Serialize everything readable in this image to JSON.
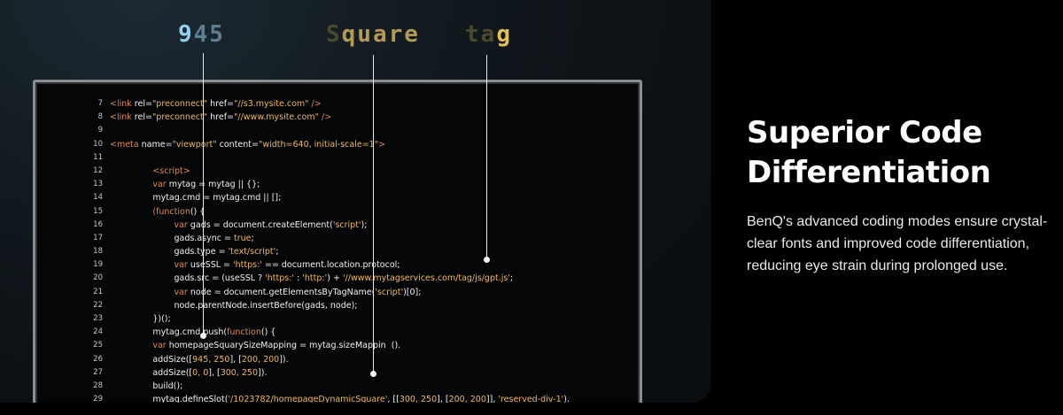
{
  "callouts": {
    "word1": {
      "parts": [
        "9",
        "45"
      ]
    },
    "word2": {
      "parts": [
        "S",
        "quare"
      ]
    },
    "word3": {
      "parts": [
        "ta",
        "g"
      ]
    }
  },
  "code_lines": [
    {
      "n": "7",
      "segs": [
        [
          "t",
          "<link "
        ],
        [
          "a",
          "rel="
        ],
        [
          "s",
          "\"preconnect\""
        ],
        [
          "a",
          " href="
        ],
        [
          "s",
          "\"//s3.mysite.com\""
        ],
        [
          "t",
          " />"
        ]
      ]
    },
    {
      "n": "8",
      "segs": [
        [
          "t",
          "<link "
        ],
        [
          "a",
          "rel="
        ],
        [
          "s",
          "\"preconnect\""
        ],
        [
          "a",
          " href="
        ],
        [
          "s",
          "\"//www.mysite.com\""
        ],
        [
          "t",
          " />"
        ]
      ]
    },
    {
      "n": "9",
      "segs": []
    },
    {
      "n": "10",
      "segs": [
        [
          "t",
          "<meta "
        ],
        [
          "a",
          "name="
        ],
        [
          "s",
          "\"viewport\""
        ],
        [
          "a",
          " content="
        ],
        [
          "s",
          "\"width=640, initial-scale=1\""
        ],
        [
          "t",
          ">"
        ]
      ]
    },
    {
      "n": "11",
      "segs": []
    },
    {
      "n": "12",
      "segs": [
        [
          "a",
          "                "
        ],
        [
          "t",
          "<script>"
        ]
      ]
    },
    {
      "n": "13",
      "segs": [
        [
          "a",
          "                "
        ],
        [
          "k",
          "var "
        ],
        [
          "a",
          "mytag = mytag || {};"
        ]
      ]
    },
    {
      "n": "14",
      "segs": [
        [
          "a",
          "                mytag.cmd = mytag.cmd || [];"
        ]
      ]
    },
    {
      "n": "15",
      "segs": [
        [
          "a",
          "                "
        ],
        [
          "k",
          "(function"
        ],
        [
          "a",
          "() {"
        ]
      ]
    },
    {
      "n": "16",
      "segs": [
        [
          "a",
          "                        "
        ],
        [
          "k",
          "var "
        ],
        [
          "a",
          "gads = document.createElement("
        ],
        [
          "s",
          "'script'"
        ],
        [
          "a",
          ");"
        ]
      ]
    },
    {
      "n": "17",
      "segs": [
        [
          "a",
          "                        gads.async = "
        ],
        [
          "n",
          "true"
        ],
        [
          "a",
          ";"
        ]
      ]
    },
    {
      "n": "18",
      "segs": [
        [
          "a",
          "                        gads.type = "
        ],
        [
          "s",
          "'text/script'"
        ],
        [
          "a",
          ";"
        ]
      ]
    },
    {
      "n": "19",
      "segs": [
        [
          "a",
          "                        "
        ],
        [
          "k",
          "var "
        ],
        [
          "a",
          "useSSL = "
        ],
        [
          "s",
          "'https:'"
        ],
        [
          "a",
          " == document.location.protocol;"
        ]
      ]
    },
    {
      "n": "20",
      "segs": [
        [
          "a",
          "                        gads.src = (useSSL ? "
        ],
        [
          "s",
          "'https:'"
        ],
        [
          "a",
          " : "
        ],
        [
          "s",
          "'http:'"
        ],
        [
          "a",
          ") + "
        ],
        [
          "s",
          "'//www.mytagservices.com/tag/js/gpt.js'"
        ],
        [
          "a",
          ";"
        ]
      ]
    },
    {
      "n": "21",
      "segs": [
        [
          "a",
          "                        "
        ],
        [
          "k",
          "var "
        ],
        [
          "a",
          "node = document.getElementsByTagName("
        ],
        [
          "s",
          "'script'"
        ],
        [
          "a",
          ")[0];"
        ]
      ]
    },
    {
      "n": "22",
      "segs": [
        [
          "a",
          "                        node.parentNode.insertBefore(gads, node);"
        ]
      ]
    },
    {
      "n": "23",
      "segs": [
        [
          "a",
          "                })();"
        ]
      ]
    },
    {
      "n": "24",
      "segs": [
        [
          "a",
          "                mytag.cmd.push("
        ],
        [
          "k",
          "function"
        ],
        [
          "a",
          "() {"
        ]
      ]
    },
    {
      "n": "25",
      "segs": [
        [
          "a",
          "                "
        ],
        [
          "k",
          "var "
        ],
        [
          "a",
          "homepageSquarySizeMapping = mytag.sizeMappin  ()."
        ]
      ]
    },
    {
      "n": "26",
      "segs": [
        [
          "a",
          "                addSize(["
        ],
        [
          "n",
          "945, 250"
        ],
        [
          "a",
          "], ["
        ],
        [
          "n",
          "200, 200"
        ],
        [
          "a",
          "])."
        ]
      ]
    },
    {
      "n": "27",
      "segs": [
        [
          "a",
          "                addSize(["
        ],
        [
          "n",
          "0, 0"
        ],
        [
          "a",
          "], ["
        ],
        [
          "n",
          "300, 250"
        ],
        [
          "a",
          "])."
        ]
      ]
    },
    {
      "n": "28",
      "segs": [
        [
          "a",
          "                build();"
        ]
      ]
    },
    {
      "n": "29",
      "segs": [
        [
          "a",
          "                mytag.defineSlot("
        ],
        [
          "s",
          "'/1023782/homepageDynamicSquare'"
        ],
        [
          "a",
          ", [["
        ],
        [
          "n",
          "300, 250"
        ],
        [
          "a",
          "], ["
        ],
        [
          "n",
          "200, 200"
        ],
        [
          "a",
          "]], "
        ],
        [
          "s",
          "'reserved-div-1'"
        ],
        [
          "a",
          ")."
        ]
      ]
    }
  ],
  "feature": {
    "heading_line1": "Superior Code",
    "heading_line2": "Differentiation",
    "description": "BenQ's advanced coding modes ensure crystal-clear fonts and improved code differentiation, reducing eye strain during prolonged use."
  },
  "colors": {
    "background": "#000000",
    "code_tag": "#e08a5a",
    "code_string": "#f1b85a",
    "callout_blue": "#8fd0ec",
    "callout_gold": "#e3bf5a"
  }
}
